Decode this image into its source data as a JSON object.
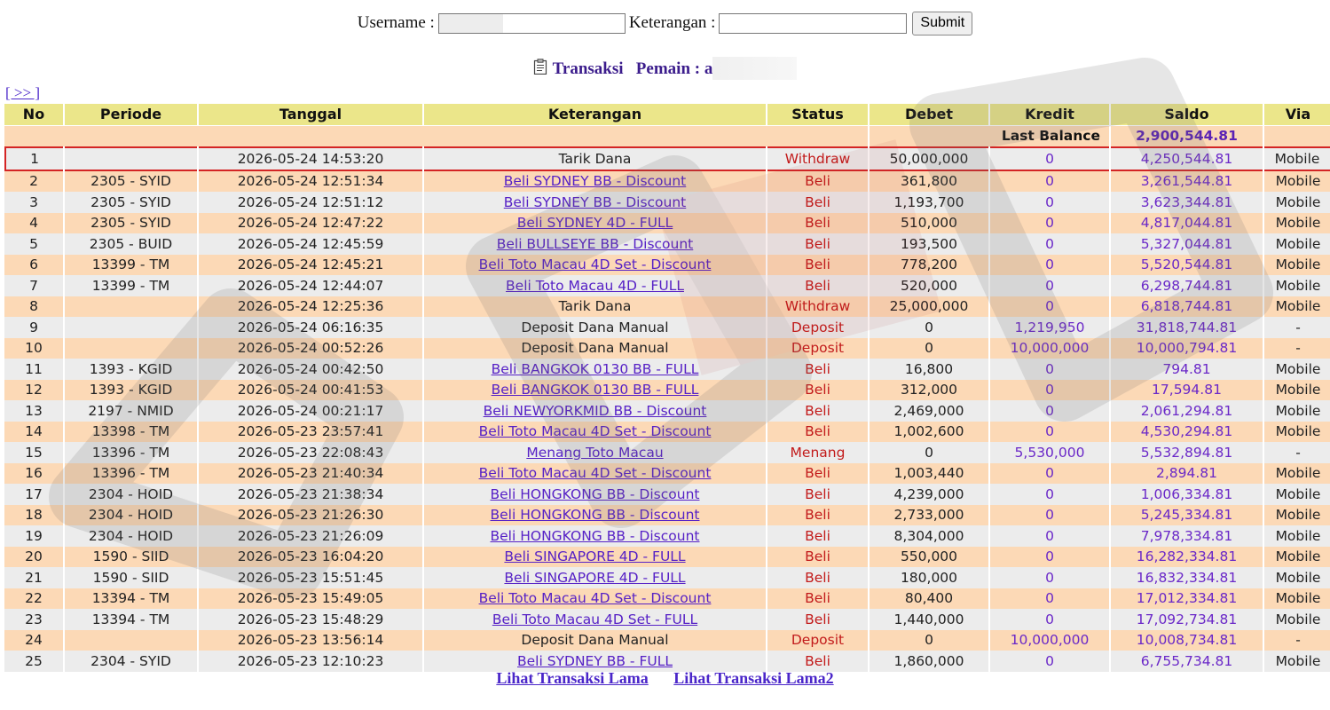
{
  "form": {
    "username_label": "Username :",
    "username_value": "",
    "keterangan_label": "Keterangan :",
    "keterangan_value": "",
    "submit_label": "Submit"
  },
  "heading": {
    "icon": "clipboard-icon",
    "title": "Transaksi",
    "player_label": "Pemain : a"
  },
  "nav": {
    "next_label": "[ >> ]"
  },
  "table": {
    "columns": [
      "No",
      "Periode",
      "Tanggal",
      "Keterangan",
      "Status",
      "Debet",
      "Kredit",
      "Saldo",
      "Via"
    ],
    "last_balance_label": "Last Balance",
    "last_balance_value": "2,900,544.81",
    "rows": [
      {
        "no": "1",
        "periode": "",
        "tanggal": "2026-05-24 14:53:20",
        "keterangan": "Tarik Dana",
        "link": false,
        "status": "Withdraw",
        "debet": "50,000,000",
        "kredit": "0",
        "saldo": "4,250,544.81",
        "via": "Mobile"
      },
      {
        "no": "2",
        "periode": "2305 - SYID",
        "tanggal": "2026-05-24 12:51:34",
        "keterangan": "Beli SYDNEY BB - Discount",
        "link": true,
        "status": "Beli",
        "debet": "361,800",
        "kredit": "0",
        "saldo": "3,261,544.81",
        "via": "Mobile"
      },
      {
        "no": "3",
        "periode": "2305 - SYID",
        "tanggal": "2026-05-24 12:51:12",
        "keterangan": "Beli SYDNEY BB - Discount",
        "link": true,
        "status": "Beli",
        "debet": "1,193,700",
        "kredit": "0",
        "saldo": "3,623,344.81",
        "via": "Mobile"
      },
      {
        "no": "4",
        "periode": "2305 - SYID",
        "tanggal": "2026-05-24 12:47:22",
        "keterangan": "Beli SYDNEY 4D - FULL",
        "link": true,
        "status": "Beli",
        "debet": "510,000",
        "kredit": "0",
        "saldo": "4,817,044.81",
        "via": "Mobile"
      },
      {
        "no": "5",
        "periode": "2305 - BUID",
        "tanggal": "2026-05-24 12:45:59",
        "keterangan": "Beli BULLSEYE BB - Discount",
        "link": true,
        "status": "Beli",
        "debet": "193,500",
        "kredit": "0",
        "saldo": "5,327,044.81",
        "via": "Mobile"
      },
      {
        "no": "6",
        "periode": "13399 - TM",
        "tanggal": "2026-05-24 12:45:21",
        "keterangan": "Beli Toto Macau 4D Set - Discount",
        "link": true,
        "status": "Beli",
        "debet": "778,200",
        "kredit": "0",
        "saldo": "5,520,544.81",
        "via": "Mobile"
      },
      {
        "no": "7",
        "periode": "13399 - TM",
        "tanggal": "2026-05-24 12:44:07",
        "keterangan": "Beli Toto Macau 4D - FULL",
        "link": true,
        "status": "Beli",
        "debet": "520,000",
        "kredit": "0",
        "saldo": "6,298,744.81",
        "via": "Mobile"
      },
      {
        "no": "8",
        "periode": "",
        "tanggal": "2026-05-24 12:25:36",
        "keterangan": "Tarik Dana",
        "link": false,
        "status": "Withdraw",
        "debet": "25,000,000",
        "kredit": "0",
        "saldo": "6,818,744.81",
        "via": "Mobile"
      },
      {
        "no": "9",
        "periode": "",
        "tanggal": "2026-05-24 06:16:35",
        "keterangan": "Deposit Dana Manual",
        "link": false,
        "status": "Deposit",
        "debet": "0",
        "kredit": "1,219,950",
        "saldo": "31,818,744.81",
        "via": "-"
      },
      {
        "no": "10",
        "periode": "",
        "tanggal": "2026-05-24 00:52:26",
        "keterangan": "Deposit Dana Manual",
        "link": false,
        "status": "Deposit",
        "debet": "0",
        "kredit": "10,000,000",
        "saldo": "10,000,794.81",
        "via": "-"
      },
      {
        "no": "11",
        "periode": "1393 - KGID",
        "tanggal": "2026-05-24 00:42:50",
        "keterangan": "Beli BANGKOK 0130 BB - FULL",
        "link": true,
        "status": "Beli",
        "debet": "16,800",
        "kredit": "0",
        "saldo": "794.81",
        "via": "Mobile"
      },
      {
        "no": "12",
        "periode": "1393 - KGID",
        "tanggal": "2026-05-24 00:41:53",
        "keterangan": "Beli BANGKOK 0130 BB - FULL",
        "link": true,
        "status": "Beli",
        "debet": "312,000",
        "kredit": "0",
        "saldo": "17,594.81",
        "via": "Mobile"
      },
      {
        "no": "13",
        "periode": "2197 - NMID",
        "tanggal": "2026-05-24 00:21:17",
        "keterangan": "Beli NEWYORKMID BB - Discount",
        "link": true,
        "status": "Beli",
        "debet": "2,469,000",
        "kredit": "0",
        "saldo": "2,061,294.81",
        "via": "Mobile"
      },
      {
        "no": "14",
        "periode": "13398 - TM",
        "tanggal": "2026-05-23 23:57:41",
        "keterangan": "Beli Toto Macau 4D Set - Discount",
        "link": true,
        "status": "Beli",
        "debet": "1,002,600",
        "kredit": "0",
        "saldo": "4,530,294.81",
        "via": "Mobile"
      },
      {
        "no": "15",
        "periode": "13396 - TM",
        "tanggal": "2026-05-23 22:08:43",
        "keterangan": "Menang Toto Macau",
        "link": true,
        "status": "Menang",
        "debet": "0",
        "kredit": "5,530,000",
        "saldo": "5,532,894.81",
        "via": "-"
      },
      {
        "no": "16",
        "periode": "13396 - TM",
        "tanggal": "2026-05-23 21:40:34",
        "keterangan": "Beli Toto Macau 4D Set - Discount",
        "link": true,
        "status": "Beli",
        "debet": "1,003,440",
        "kredit": "0",
        "saldo": "2,894.81",
        "via": "Mobile"
      },
      {
        "no": "17",
        "periode": "2304 - HOID",
        "tanggal": "2026-05-23 21:38:34",
        "keterangan": "Beli HONGKONG BB - Discount",
        "link": true,
        "status": "Beli",
        "debet": "4,239,000",
        "kredit": "0",
        "saldo": "1,006,334.81",
        "via": "Mobile"
      },
      {
        "no": "18",
        "periode": "2304 - HOID",
        "tanggal": "2026-05-23 21:26:30",
        "keterangan": "Beli HONGKONG BB - Discount",
        "link": true,
        "status": "Beli",
        "debet": "2,733,000",
        "kredit": "0",
        "saldo": "5,245,334.81",
        "via": "Mobile"
      },
      {
        "no": "19",
        "periode": "2304 - HOID",
        "tanggal": "2026-05-23 21:26:09",
        "keterangan": "Beli HONGKONG BB - Discount",
        "link": true,
        "status": "Beli",
        "debet": "8,304,000",
        "kredit": "0",
        "saldo": "7,978,334.81",
        "via": "Mobile"
      },
      {
        "no": "20",
        "periode": "1590 - SIID",
        "tanggal": "2026-05-23 16:04:20",
        "keterangan": "Beli SINGAPORE 4D - FULL",
        "link": true,
        "status": "Beli",
        "debet": "550,000",
        "kredit": "0",
        "saldo": "16,282,334.81",
        "via": "Mobile"
      },
      {
        "no": "21",
        "periode": "1590 - SIID",
        "tanggal": "2026-05-23 15:51:45",
        "keterangan": "Beli SINGAPORE 4D - FULL",
        "link": true,
        "status": "Beli",
        "debet": "180,000",
        "kredit": "0",
        "saldo": "16,832,334.81",
        "via": "Mobile"
      },
      {
        "no": "22",
        "periode": "13394 - TM",
        "tanggal": "2026-05-23 15:49:05",
        "keterangan": "Beli Toto Macau 4D Set - Discount",
        "link": true,
        "status": "Beli",
        "debet": "80,400",
        "kredit": "0",
        "saldo": "17,012,334.81",
        "via": "Mobile"
      },
      {
        "no": "23",
        "periode": "13394 - TM",
        "tanggal": "2026-05-23 15:48:29",
        "keterangan": "Beli Toto Macau 4D Set - FULL",
        "link": true,
        "status": "Beli",
        "debet": "1,440,000",
        "kredit": "0",
        "saldo": "17,092,734.81",
        "via": "Mobile"
      },
      {
        "no": "24",
        "periode": "",
        "tanggal": "2026-05-23 13:56:14",
        "keterangan": "Deposit Dana Manual",
        "link": false,
        "status": "Deposit",
        "debet": "0",
        "kredit": "10,000,000",
        "saldo": "10,008,734.81",
        "via": "-"
      },
      {
        "no": "25",
        "periode": "2304 - SYID",
        "tanggal": "2026-05-23 12:10:23",
        "keterangan": "Beli SYDNEY BB - FULL",
        "link": true,
        "status": "Beli",
        "debet": "1,860,000",
        "kredit": "0",
        "saldo": "6,755,734.81",
        "via": "Mobile"
      }
    ]
  },
  "footer": {
    "link1": "Lihat Transaksi Lama",
    "link2": "Lihat Transaksi Lama2"
  },
  "colors": {
    "header_bg": "#ebe68a",
    "row_odd": "#ececec",
    "row_even": "#fcd9b6",
    "status_text": "#c21a1a",
    "link_text": "#5621c6",
    "highlight_border": "#d42424"
  }
}
